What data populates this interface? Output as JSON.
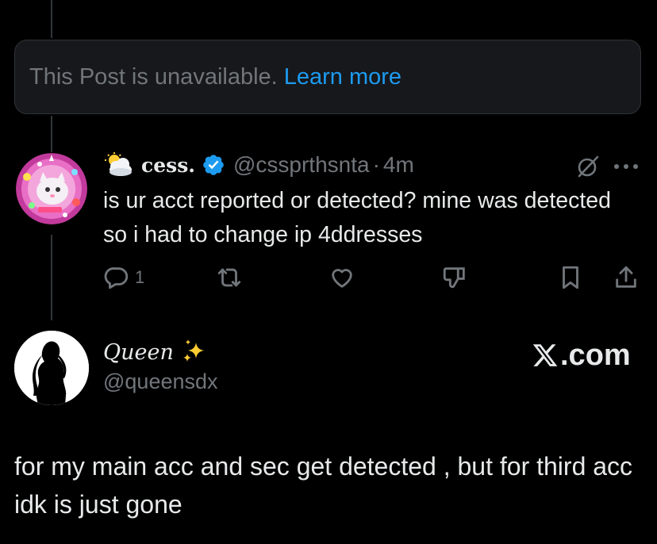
{
  "unavailable": {
    "text": "This Post is unavailable.",
    "link": "Learn more"
  },
  "reply": {
    "name": "cess.",
    "handle": "@cssprthsnta",
    "separator": "·",
    "time": "4m",
    "text": "is ur acct reported or detected? mine was detected so i had to change ip 4ddresses",
    "reply_count": "1",
    "name_emoji_icon": "sun-behind-cloud-icon"
  },
  "author": {
    "name": "Queen",
    "name_emoji_icon": "sparkles-icon",
    "handle": "@queensdx",
    "brand": ".com"
  },
  "main": {
    "text": "for my main acc and sec get detected , but for third acc idk is just gone"
  },
  "colors": {
    "background": "#000000",
    "text_primary": "#e7e9ea",
    "text_secondary": "#71767b",
    "link": "#1d9bf0",
    "verified": "#1d9bf0"
  }
}
